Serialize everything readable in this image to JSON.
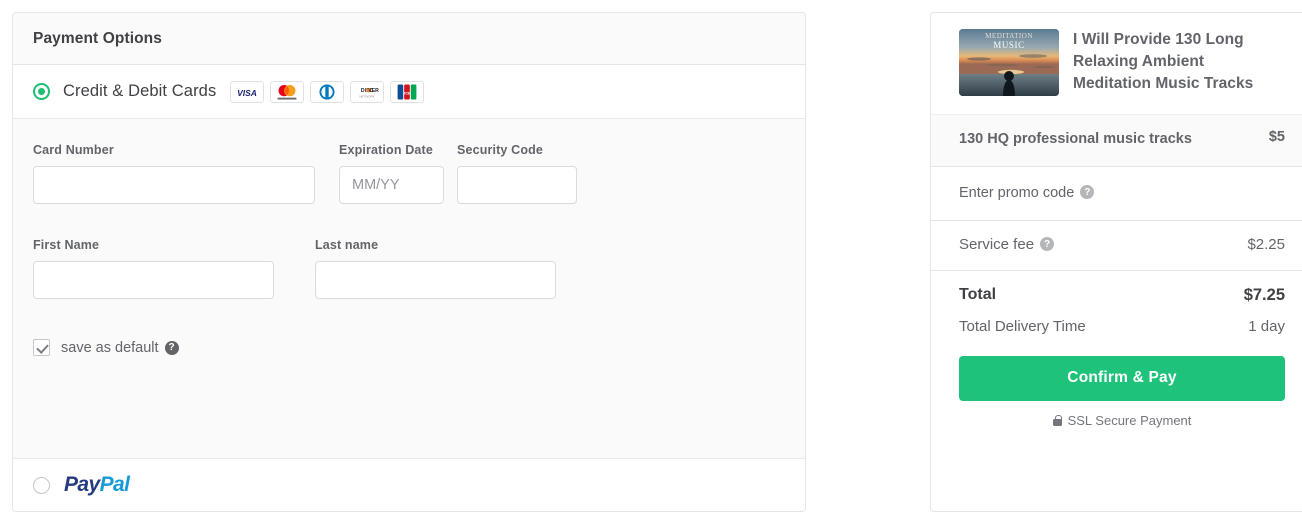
{
  "payment_panel": {
    "title": "Payment Options",
    "credit_option": {
      "label": "Credit & Debit Cards",
      "selected": true,
      "accepted_cards": [
        {
          "name": "visa-card-icon",
          "label": "VISA"
        },
        {
          "name": "mastercard-card-icon",
          "label": "mastercard"
        },
        {
          "name": "diners-club-card-icon",
          "label": "Diners Club"
        },
        {
          "name": "discover-card-icon",
          "label": "DISCOVER"
        },
        {
          "name": "jcb-card-icon",
          "label": "JCB"
        }
      ]
    },
    "form": {
      "card_number_label": "Card Number",
      "card_number_value": "",
      "card_number_placeholder": "",
      "expiration_label": "Expiration Date",
      "expiration_value": "",
      "expiration_placeholder": "MM/YY",
      "security_code_label": "Security Code",
      "security_code_value": "",
      "security_code_placeholder": "",
      "first_name_label": "First Name",
      "first_name_value": "",
      "first_name_placeholder": "",
      "last_name_label": "Last name",
      "last_name_value": "",
      "last_name_placeholder": "",
      "save_default_label": "save as default",
      "save_default_checked": true,
      "help_glyph": "?"
    },
    "paypal_option": {
      "label": "PayPal",
      "logo_part_one": "Pay",
      "logo_part_two": "Pal",
      "selected": false
    }
  },
  "summary": {
    "item": {
      "title": "I Will Provide 130 Long Relaxing Ambient Meditation Music Tracks",
      "thumbnail_caption_line1": "MEDITATION",
      "thumbnail_caption_line2": "MUSIC"
    },
    "package": {
      "label": "130 HQ professional music tracks",
      "price": "$5"
    },
    "promo": {
      "label": "Enter promo code",
      "help_glyph": "?"
    },
    "service_fee": {
      "label": "Service fee",
      "value": "$2.25",
      "help_glyph": "?"
    },
    "total": {
      "label": "Total",
      "value": "$7.25"
    },
    "delivery": {
      "label": "Total Delivery Time",
      "value": "1 day"
    },
    "confirm_button": "Confirm & Pay",
    "ssl_note": "SSL Secure Payment"
  },
  "colors": {
    "accent_green": "#1ec27a",
    "radio_green": "#1dbf73",
    "text_primary": "#404145",
    "text_secondary": "#62646a",
    "paypal_dark": "#253b80",
    "paypal_light": "#179bd7"
  }
}
